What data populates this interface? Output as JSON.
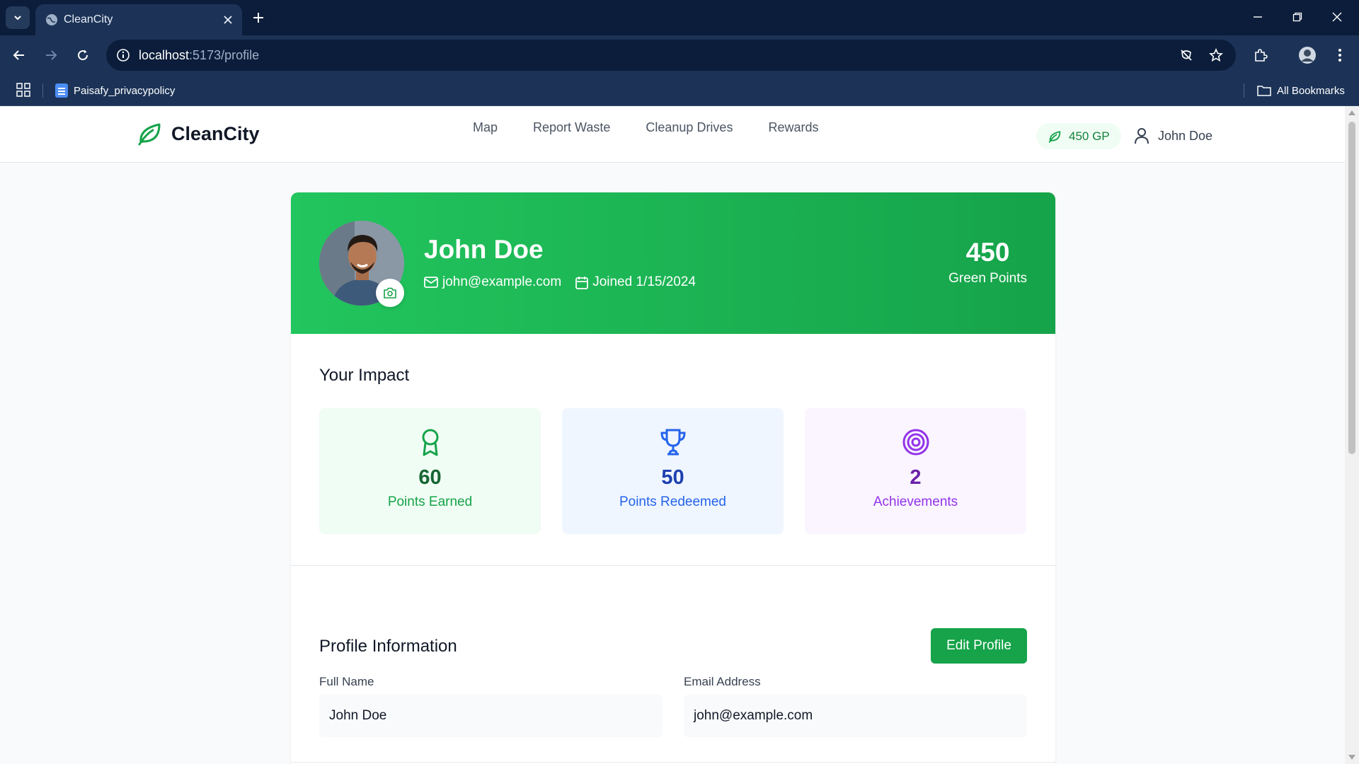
{
  "browser": {
    "tab_title": "CleanCity",
    "url_host": "localhost",
    "url_path": ":5173/profile",
    "bookmark": "Paisafy_privacypolicy",
    "all_bookmarks": "All Bookmarks"
  },
  "header": {
    "brand": "CleanCity",
    "nav": [
      "Map",
      "Report Waste",
      "Cleanup Drives",
      "Rewards"
    ],
    "points_badge": "450 GP",
    "user_name": "John Doe"
  },
  "profile": {
    "name": "John Doe",
    "email": "john@example.com",
    "joined": "Joined 1/15/2024",
    "points_value": "450",
    "points_label": "Green Points"
  },
  "impact": {
    "title": "Your Impact",
    "stats": [
      {
        "value": "60",
        "label": "Points Earned",
        "icon": "award-icon",
        "color": "#16a34a"
      },
      {
        "value": "50",
        "label": "Points Redeemed",
        "icon": "trophy-icon",
        "color": "#2563eb"
      },
      {
        "value": "2",
        "label": "Achievements",
        "icon": "target-icon",
        "color": "#9333ea"
      }
    ]
  },
  "info": {
    "title": "Profile Information",
    "edit_label": "Edit Profile",
    "full_name_label": "Full Name",
    "full_name_value": "John Doe",
    "email_label": "Email Address",
    "email_value": "john@example.com"
  },
  "colors": {
    "brand_green": "#16a34a",
    "hero_gradient_start": "#22c55e",
    "browser_dark": "#0b1d3a"
  }
}
